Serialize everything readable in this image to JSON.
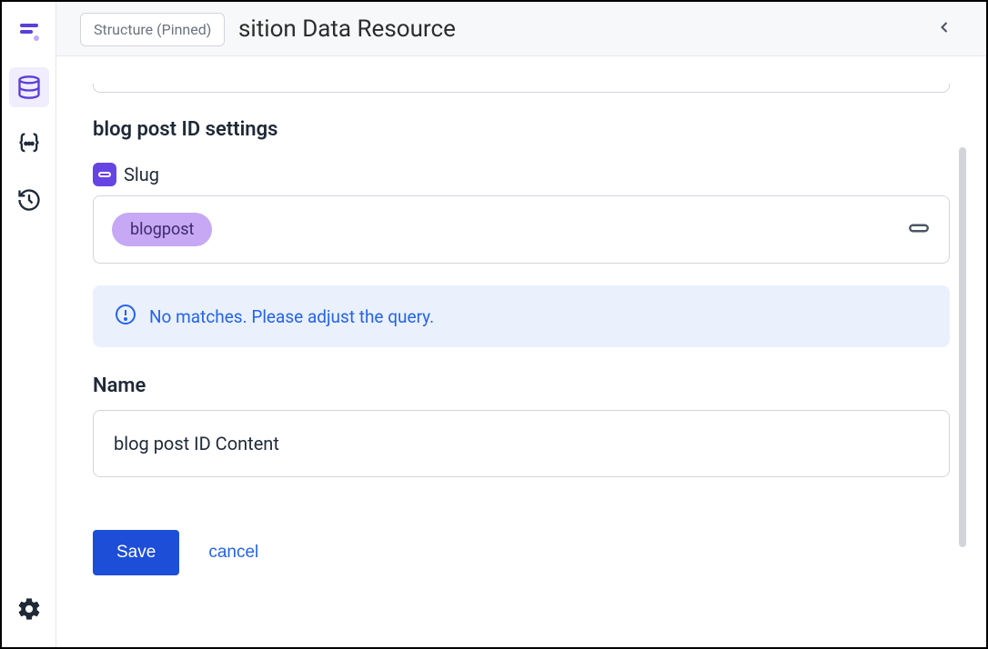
{
  "tooltip": {
    "label": "Structure (Pinned)"
  },
  "header": {
    "title_partial": "sition Data Resource"
  },
  "section": {
    "title": "blog post ID settings"
  },
  "slug": {
    "label": "Slug",
    "chip": "blogpost"
  },
  "alert": {
    "message": "No matches. Please adjust the query."
  },
  "name": {
    "label": "Name",
    "value": "blog post ID Content"
  },
  "actions": {
    "save": "Save",
    "cancel": "cancel"
  },
  "icons": {
    "logo": "logo",
    "database": "database",
    "code": "code-braces",
    "history": "history",
    "gear": "gear",
    "link": "link",
    "alert": "alert-circle",
    "chevron_left": "chevron-left"
  }
}
